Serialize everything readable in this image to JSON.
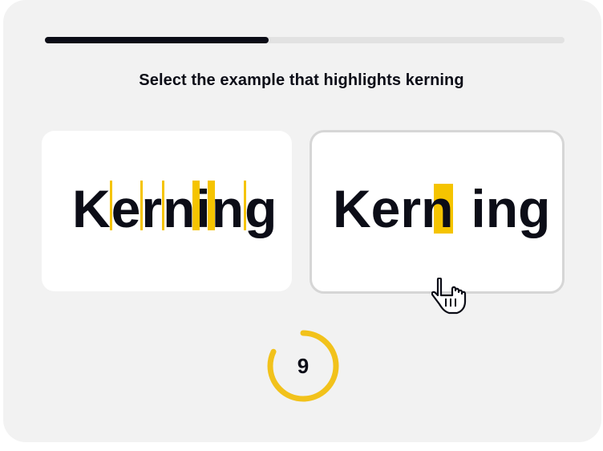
{
  "progress": {
    "fraction": 0.43
  },
  "question": {
    "text": "Select the example that highlights kerning"
  },
  "options": [
    {
      "id": "a",
      "word": "Kerning",
      "highlight_style": "thin bars between every letter"
    },
    {
      "id": "b",
      "word": "Kerning",
      "highlight_style": "single block between n and i"
    }
  ],
  "timer": {
    "value": "9",
    "fraction_remaining": 0.82,
    "color": "#f2c21b"
  },
  "colors": {
    "accent": "#f5c400",
    "text": "#0c0d17",
    "background": "#f2f2f2",
    "card": "#ffffff",
    "selected_border": "#d6d6d6"
  },
  "icons": {
    "cursor": "hand-pointer-icon"
  }
}
